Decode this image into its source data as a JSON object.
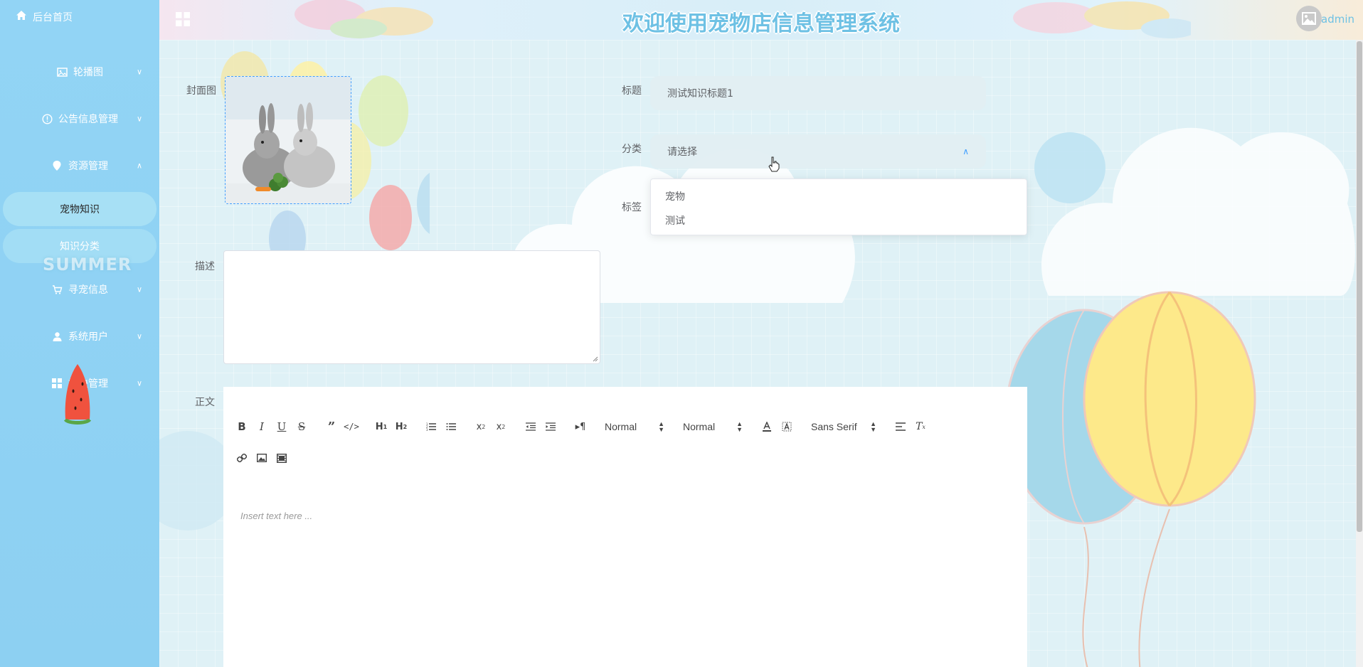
{
  "sidebar": {
    "home": "后台首页",
    "menus": [
      {
        "label": "轮播图",
        "icon": "image-icon"
      },
      {
        "label": "公告信息管理",
        "icon": "info-icon"
      },
      {
        "label": "资源管理",
        "icon": "location-icon"
      },
      {
        "label": "寻宠信息",
        "icon": "cart-icon"
      },
      {
        "label": "系统用户",
        "icon": "user-icon"
      },
      {
        "label": "模块管理",
        "icon": "grid-icon"
      }
    ],
    "sub_items": [
      "宠物知识",
      "知识分类"
    ],
    "decor_text": "SUMMER"
  },
  "header": {
    "title": "欢迎使用宠物店信息管理系统",
    "username": "admin"
  },
  "form": {
    "cover_label": "封面图",
    "title_label": "标题",
    "title_value": "测试知识标题1",
    "category_label": "分类",
    "category_placeholder": "请选择",
    "tags_label": "标签",
    "desc_label": "描述",
    "body_label": "正文",
    "category_options": [
      "宠物",
      "测试"
    ]
  },
  "editor": {
    "header_select": "Normal",
    "size_select": "Normal",
    "font_select": "Sans Serif",
    "placeholder": "Insert text here ..."
  }
}
